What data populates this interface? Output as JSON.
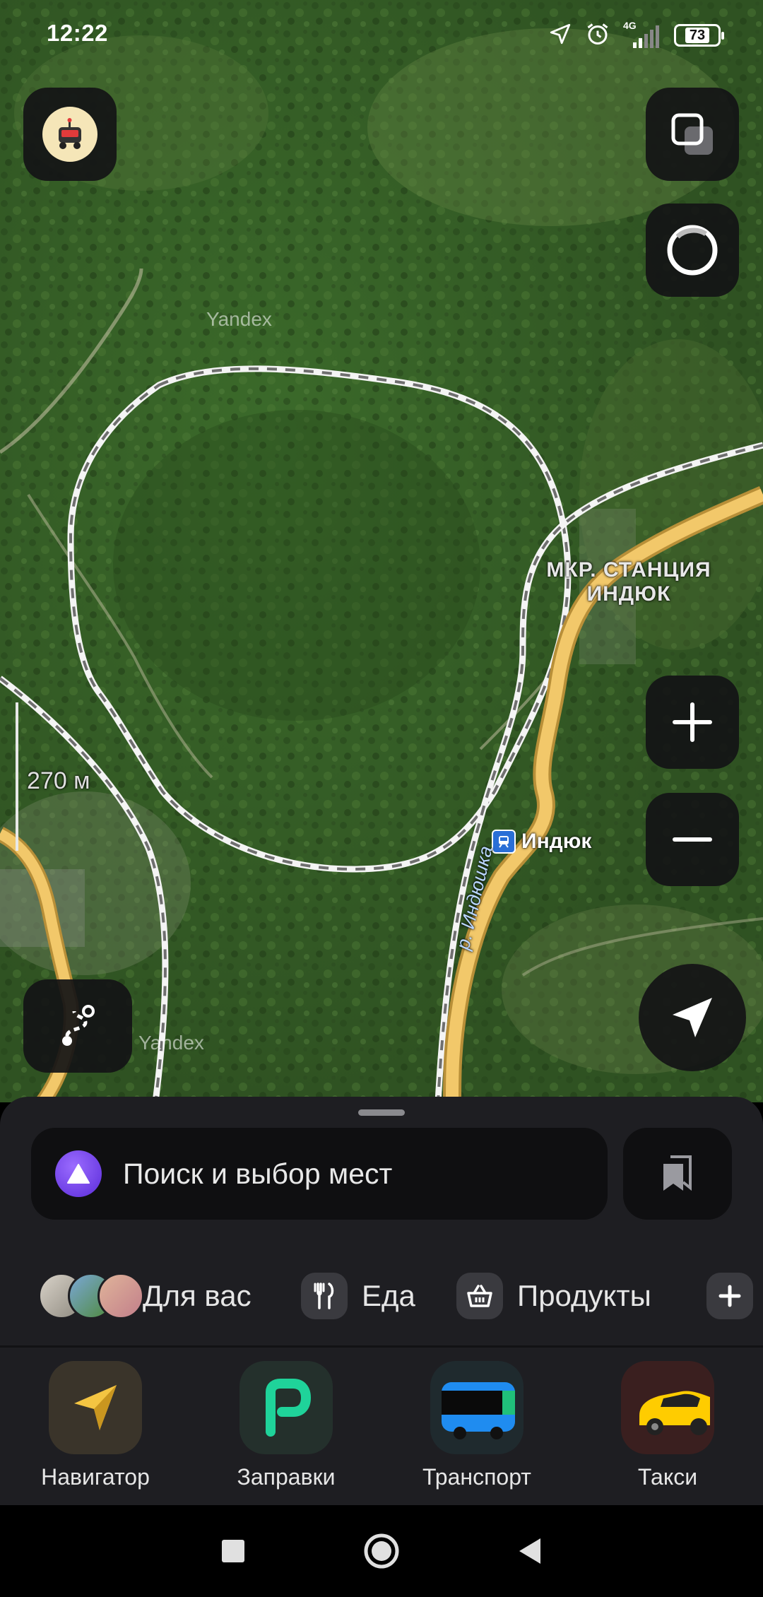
{
  "status_bar": {
    "time": "12:22",
    "network": "4G",
    "battery": "73",
    "icons": [
      "location-arrow-icon",
      "alarm-icon",
      "signal-icon",
      "battery-icon"
    ]
  },
  "map": {
    "district_label": "МКР. СТАНЦИЯ ИНДЮК",
    "station_label": "Индюк",
    "river_label": "р. Индюшка",
    "watermark": "Yandex",
    "scale_label": "270 м",
    "road_color": "#f2c86a",
    "railway_color": "#ffffff"
  },
  "map_controls": {
    "profile_icon": "robot-avatar-icon",
    "layers_icon": "layers-icon",
    "alice_icon": "alice-ring-icon",
    "zoom_in_icon": "plus-icon",
    "zoom_out_icon": "minus-icon",
    "locate_icon": "navigation-arrow-icon",
    "route_icon": "route-icon"
  },
  "sheet": {
    "search_placeholder": "Поиск и выбор мест",
    "bookmarks_icon": "bookmarks-icon",
    "categories": [
      {
        "label": "Для вас",
        "icon": "photo-thumbnails"
      },
      {
        "label": "Еда",
        "icon": "fork-knife-icon"
      },
      {
        "label": "Продукты",
        "icon": "basket-icon"
      },
      {
        "label": "",
        "icon": "plus-icon"
      }
    ],
    "services": [
      {
        "label": "Навигатор",
        "icon": "navigator-arrow-icon"
      },
      {
        "label": "Заправки",
        "icon": "fuel-p-icon"
      },
      {
        "label": "Транспорт",
        "icon": "bus-icon"
      },
      {
        "label": "Такси",
        "icon": "taxi-car-icon"
      }
    ]
  },
  "nav_bar": {
    "icons": [
      "recents-square-icon",
      "home-circle-icon",
      "back-triangle-icon"
    ]
  },
  "colors": {
    "sheet_bg": "#1e1e22",
    "accent_alice": "#7b4dff",
    "fuel_green": "#1fd39a",
    "taxi_yellow": "#ffcc00"
  }
}
